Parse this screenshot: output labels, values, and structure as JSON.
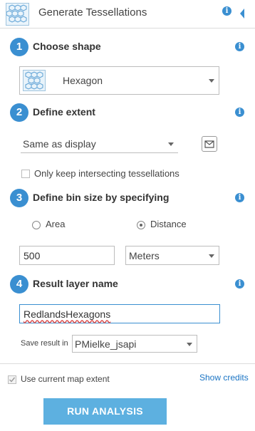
{
  "header": {
    "title": "Generate Tessellations"
  },
  "steps": {
    "s1": {
      "number": "1",
      "label": "Choose shape",
      "shape_value": "Hexagon"
    },
    "s2": {
      "number": "2",
      "label": "Define extent",
      "extent_value": "Same as display",
      "intersect_label": "Only keep intersecting tessellations"
    },
    "s3": {
      "number": "3",
      "label": "Define bin size by specifying",
      "option_area": "Area",
      "option_distance": "Distance",
      "selected": "Distance",
      "size_value": "500",
      "unit_value": "Meters"
    },
    "s4": {
      "number": "4",
      "label": "Result layer name",
      "name_value": "RedlandsHexagons",
      "save_label": "Save result in",
      "save_value": "PMielke_jsapi"
    }
  },
  "footer": {
    "extent_label": "Use current map extent",
    "extent_checked": true,
    "credits_link": "Show credits",
    "run_label": "RUN ANALYSIS"
  },
  "colors": {
    "accent": "#3a8fd1",
    "button": "#5db0e0",
    "link": "#1a74c4"
  },
  "icons": [
    "hexagon-grid-icon",
    "info-icon",
    "collapse-arrow-icon",
    "draw-extent-icon",
    "chevron-down-icon"
  ]
}
